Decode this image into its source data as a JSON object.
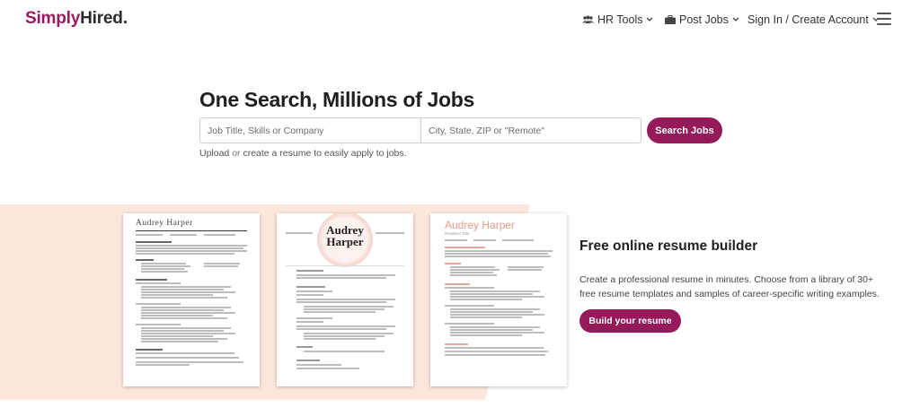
{
  "header": {
    "logo": {
      "part1": "Simply",
      "part2": "Hired",
      "dot": "."
    },
    "nav": {
      "hr_tools": "HR Tools",
      "post_jobs": "Post Jobs",
      "sign_in": "Sign In / Create Account"
    }
  },
  "hero": {
    "title": "One Search, Millions of Jobs",
    "what_placeholder": "Job Title, Skills or Company",
    "where_placeholder": "City, State, ZIP or \"Remote\"",
    "search_button": "Search Jobs",
    "upload_link": "Upload",
    "or_text": " or ",
    "create_link": "create a resume",
    "tail_text": " to easily apply to jobs."
  },
  "resume_section": {
    "title": "Free online resume builder",
    "description": "Create a professional resume in minutes. Choose from a library of 30+ free resume templates and samples of career-specific writing examples.",
    "button": "Build your resume",
    "samples": [
      {
        "name": "Audrey  Harper"
      },
      {
        "name": "Audrey Harper"
      },
      {
        "name": "Audrey Harper",
        "subtitle": "Resident Title"
      }
    ]
  },
  "colors": {
    "brand": "#961a5a",
    "band_bg": "#fde7dc"
  }
}
